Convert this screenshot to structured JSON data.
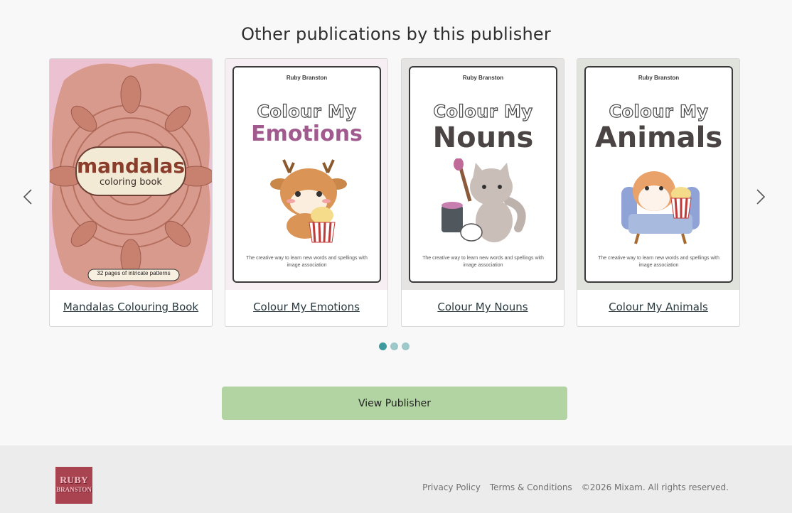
{
  "heading": "Other publications by this publisher",
  "carousel": {
    "prev_icon": "chevron-left-icon",
    "next_icon": "chevron-right-icon",
    "items": [
      {
        "title": "Mandalas Colouring Book",
        "cover": {
          "badge_line1": "mandalas",
          "badge_line2": "coloring book",
          "footer": "32 pages of intricate patterns"
        }
      },
      {
        "title": "Colour My Emotions",
        "cover": {
          "author": "Ruby Branston",
          "line1": "Colour My",
          "line2": "Emotions",
          "line2_color": "#a05a8e",
          "tagline": "The creative way to learn new words and spellings with image association",
          "bg": "#f6eef2",
          "art": "deer-icon"
        }
      },
      {
        "title": "Colour My Nouns",
        "cover": {
          "author": "Ruby Branston",
          "line1": "Colour My",
          "line2": "Nouns",
          "line2_color": "#4a4444",
          "tagline": "The creative way to learn new words and spellings with image association",
          "bg": "#e6e3e3",
          "art": "cat-icon"
        }
      },
      {
        "title": "Colour My Animals",
        "cover": {
          "author": "Ruby Branston",
          "line1": "Colour My",
          "line2": "Animals",
          "line2_color": "#4a4444",
          "tagline": "The creative way to learn new words and spellings with image association",
          "bg": "#dfe3dc",
          "art": "hamster-icon"
        }
      }
    ],
    "dots": {
      "count": 3,
      "active": 0
    }
  },
  "view_publisher_label": "View Publisher",
  "footer": {
    "logo_line1": "RUBY",
    "logo_line2": "BRANSTON",
    "privacy": "Privacy Policy",
    "terms": "Terms & Conditions",
    "copyright": "©2026 Mixam. All rights reserved."
  },
  "colors": {
    "accent_button": "#b2d3a2",
    "dot_active": "#3f9a9e",
    "dot_inactive": "#9dc9cb",
    "logo_bg": "#a8434f"
  }
}
